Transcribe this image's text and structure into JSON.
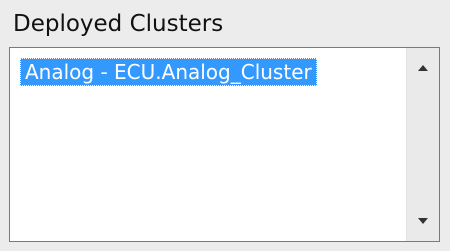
{
  "group": {
    "title": "Deployed Clusters"
  },
  "list": {
    "items": [
      {
        "label": "Analog - ECU.Analog_Cluster",
        "selected": true
      }
    ],
    "selection_color": "#3399ff"
  },
  "scrollbar": {
    "up_icon": "arrow-up-icon",
    "down_icon": "arrow-down-icon"
  }
}
